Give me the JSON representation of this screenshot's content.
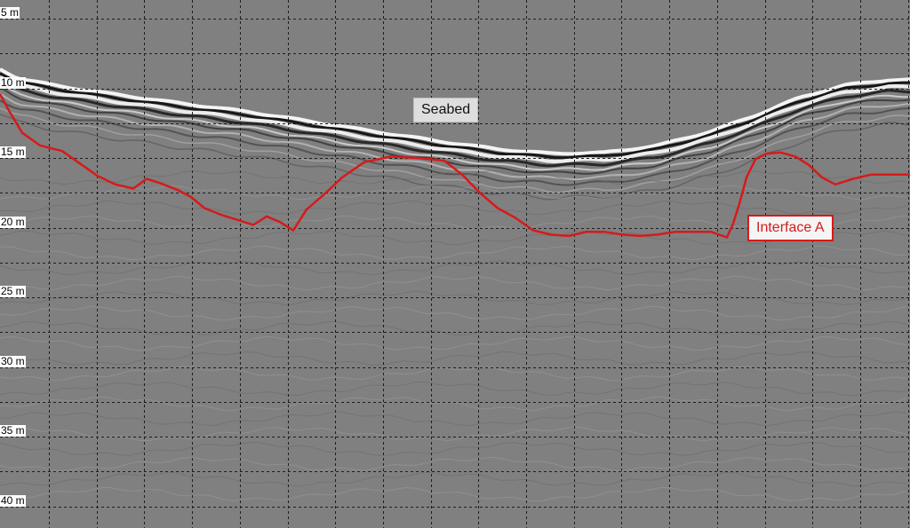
{
  "depth_labels": [
    "5 m",
    "10 m",
    "15 m",
    "20 m",
    "25 m",
    "30 m",
    "35 m",
    "40 m"
  ],
  "annotations": {
    "seabed": "Seabed",
    "interface": "Interface A"
  },
  "colors": {
    "background": "#808080",
    "grid": "#1e1e1e",
    "interface_line": "#d71a1a",
    "label_bg": "#ffffff"
  },
  "interface_a_trace_m": [
    [
      0,
      10.4
    ],
    [
      10,
      11.6
    ],
    [
      25,
      13.2
    ],
    [
      45,
      14.1
    ],
    [
      70,
      14.5
    ],
    [
      90,
      15.4
    ],
    [
      110,
      16.3
    ],
    [
      130,
      16.9
    ],
    [
      150,
      17.2
    ],
    [
      165,
      16.5
    ],
    [
      180,
      16.8
    ],
    [
      200,
      17.3
    ],
    [
      215,
      17.8
    ],
    [
      230,
      18.6
    ],
    [
      250,
      19.1
    ],
    [
      265,
      19.4
    ],
    [
      285,
      19.8
    ],
    [
      300,
      19.2
    ],
    [
      315,
      19.6
    ],
    [
      330,
      20.2
    ],
    [
      345,
      18.7
    ],
    [
      365,
      17.6
    ],
    [
      385,
      16.4
    ],
    [
      410,
      15.3
    ],
    [
      440,
      14.9
    ],
    [
      470,
      15.0
    ],
    [
      500,
      15.2
    ],
    [
      520,
      16.2
    ],
    [
      540,
      17.5
    ],
    [
      560,
      18.6
    ],
    [
      580,
      19.3
    ],
    [
      600,
      20.2
    ],
    [
      620,
      20.5
    ],
    [
      640,
      20.6
    ],
    [
      660,
      20.3
    ],
    [
      680,
      20.3
    ],
    [
      700,
      20.5
    ],
    [
      720,
      20.6
    ],
    [
      740,
      20.5
    ],
    [
      760,
      20.3
    ],
    [
      780,
      20.3
    ],
    [
      800,
      20.3
    ],
    [
      818,
      20.7
    ],
    [
      825,
      19.7
    ],
    [
      832,
      18.3
    ],
    [
      840,
      16.4
    ],
    [
      850,
      15.1
    ],
    [
      862,
      14.7
    ],
    [
      878,
      14.6
    ],
    [
      895,
      14.9
    ],
    [
      910,
      15.5
    ],
    [
      925,
      16.4
    ],
    [
      940,
      16.9
    ],
    [
      960,
      16.5
    ],
    [
      980,
      16.2
    ],
    [
      1000,
      16.2
    ],
    [
      1024,
      16.2
    ]
  ]
}
